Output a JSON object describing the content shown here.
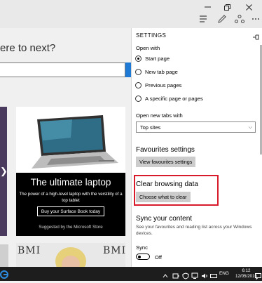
{
  "page": {
    "headline": "ere to next?",
    "ad": {
      "title": "The ultimate laptop",
      "subtitle": "The power of a high-level laptop with the verstility of a top tablet",
      "button_label": "Buy your Surface Book today",
      "footer": "Suggested by the Microsoft Store"
    },
    "thumb_text": "BMI"
  },
  "settings": {
    "title": "SETTINGS",
    "open_with_label": "Open with",
    "open_with_options": [
      {
        "label": "Start page",
        "selected": true
      },
      {
        "label": "New tab page",
        "selected": false
      },
      {
        "label": "Previous pages",
        "selected": false
      },
      {
        "label": "A specific page or pages",
        "selected": false
      }
    ],
    "open_new_tabs_label": "Open new tabs with",
    "open_new_tabs_value": "Top sites",
    "favourites_heading": "Favourites settings",
    "favourites_button": "View favourites settings",
    "clear_heading": "Clear browsing data",
    "clear_button": "Choose what to clear",
    "sync_heading": "Sync your content",
    "sync_description": "See your favourites and reading list across your Windows devices.",
    "sync_label": "Sync",
    "sync_state": "Off"
  },
  "taskbar": {
    "language": "ENG",
    "time": "6:12",
    "date": "12/05/2016"
  },
  "colors": {
    "highlight_border": "#d81a2b",
    "accent": "#1e7ad4",
    "taskbar": "#1d1d1d"
  }
}
